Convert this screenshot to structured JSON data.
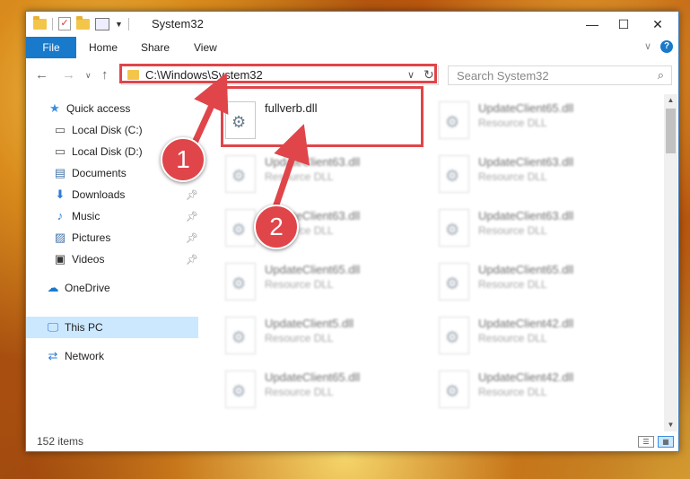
{
  "window": {
    "title": "System32",
    "controls": {
      "minimize": "—",
      "maximize": "☐",
      "close": "✕"
    }
  },
  "ribbon": {
    "tabs": [
      "File",
      "Home",
      "Share",
      "View"
    ],
    "help": "?"
  },
  "address_bar": {
    "path": "C:\\Windows\\System32",
    "search_placeholder": "Search System32"
  },
  "sidebar": {
    "items": [
      {
        "label": "Quick access",
        "icon": "star-icon",
        "pinned": false
      },
      {
        "label": "Local Disk (C:)",
        "icon": "drive-icon",
        "pinned": false
      },
      {
        "label": "Local Disk (D:)",
        "icon": "drive-icon",
        "pinned": false
      },
      {
        "label": "Documents",
        "icon": "documents-icon",
        "pinned": true
      },
      {
        "label": "Downloads",
        "icon": "download-icon",
        "pinned": true
      },
      {
        "label": "Music",
        "icon": "music-icon",
        "pinned": true
      },
      {
        "label": "Pictures",
        "icon": "pictures-icon",
        "pinned": true
      },
      {
        "label": "Videos",
        "icon": "videos-icon",
        "pinned": true
      },
      {
        "label": "OneDrive",
        "icon": "cloud-icon",
        "pinned": false
      },
      {
        "label": "This PC",
        "icon": "computer-icon",
        "pinned": false,
        "selected": true
      },
      {
        "label": "Network",
        "icon": "network-icon",
        "pinned": false
      }
    ]
  },
  "files": [
    {
      "name": "fullverb.dll",
      "type": "",
      "blurred": false
    },
    {
      "name": "UpdateClient65.dll",
      "type": "Resource DLL",
      "blurred": true
    },
    {
      "name": "UpdateClient63.dll",
      "type": "Resource DLL",
      "blurred": true
    },
    {
      "name": "UpdateClient63.dll",
      "type": "Resource DLL",
      "blurred": true
    },
    {
      "name": "UpdateClient63.dll",
      "type": "Resource DLL",
      "blurred": true
    },
    {
      "name": "UpdateClient63.dll",
      "type": "Resource DLL",
      "blurred": true
    },
    {
      "name": "UpdateClient65.dll",
      "type": "Resource DLL",
      "blurred": true
    },
    {
      "name": "UpdateClient65.dll",
      "type": "Resource DLL",
      "blurred": true
    },
    {
      "name": "UpdateClient5.dll",
      "type": "Resource DLL",
      "blurred": true
    },
    {
      "name": "UpdateClient42.dll",
      "type": "Resource DLL",
      "blurred": true
    },
    {
      "name": "UpdateClient65.dll",
      "type": "Resource DLL",
      "blurred": true
    },
    {
      "name": "UpdateClient42.dll",
      "type": "Resource DLL",
      "blurred": true
    }
  ],
  "status": {
    "item_count": "152 items"
  },
  "callouts": [
    "1",
    "2"
  ],
  "colors": {
    "accent": "#1979ca",
    "highlight": "#e0454a",
    "selection": "#cce8ff"
  }
}
